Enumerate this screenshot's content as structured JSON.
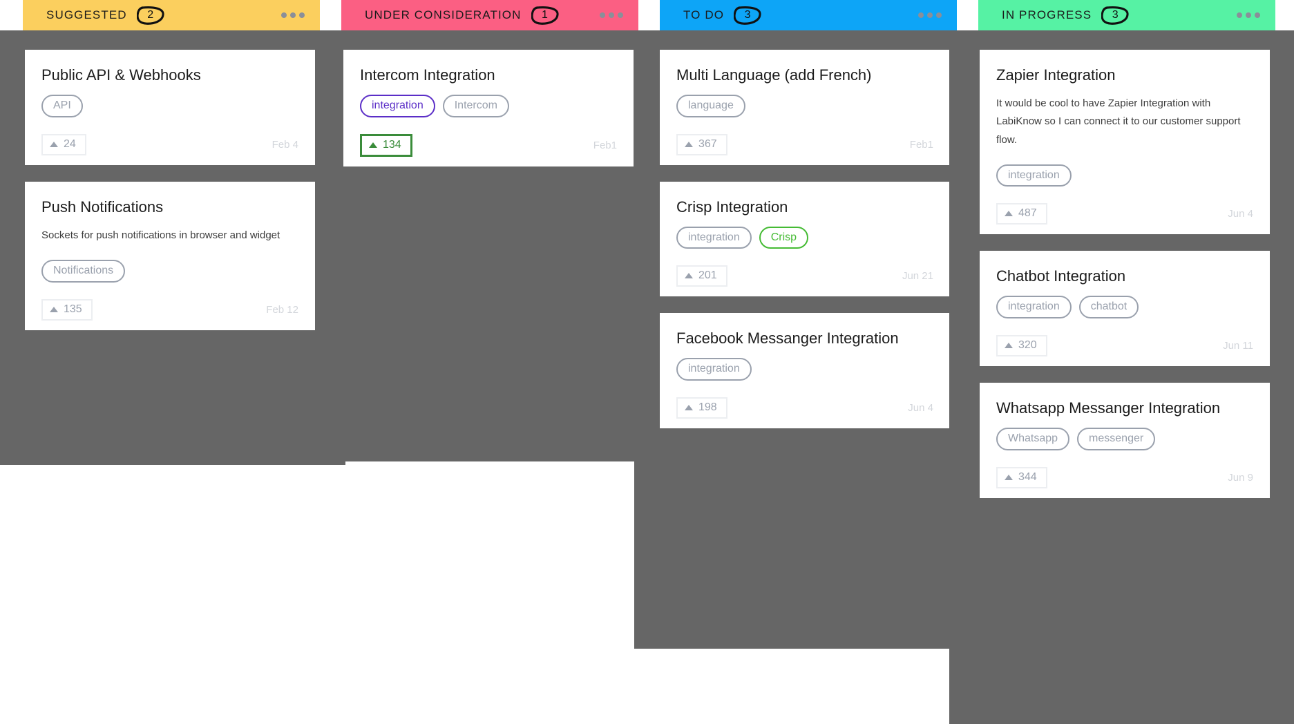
{
  "columns": [
    {
      "id": "suggested",
      "title": "SUGGESTED",
      "count": "2",
      "color": "#fbcf5e",
      "menu_icon": "ellipsis-icon",
      "cards": [
        {
          "title": "Public API & Webhooks",
          "desc": "",
          "tags": [
            {
              "label": "API",
              "state": "default"
            }
          ],
          "votes": "24",
          "voted": false,
          "date": "Feb 4"
        },
        {
          "title": "Push Notifications",
          "desc": "Sockets for push notifications in browser and widget",
          "tags": [
            {
              "label": "Notifications",
              "state": "default"
            }
          ],
          "votes": "135",
          "voted": false,
          "date": "Feb 12"
        }
      ]
    },
    {
      "id": "under-consideration",
      "title": "UNDER CONSIDERATION",
      "count": "1",
      "color": "#fb5f83",
      "menu_icon": "ellipsis-icon",
      "cards": [
        {
          "title": "Intercom Integration",
          "desc": "",
          "tags": [
            {
              "label": "integration",
              "state": "purple"
            },
            {
              "label": "Intercom",
              "state": "default"
            }
          ],
          "votes": "134",
          "voted": true,
          "date": "Feb1"
        }
      ]
    },
    {
      "id": "to-do",
      "title": "TO DO",
      "count": "3",
      "color": "#0da5f7",
      "menu_icon": "ellipsis-icon",
      "cards": [
        {
          "title": "Multi Language (add French)",
          "desc": "",
          "tags": [
            {
              "label": "language",
              "state": "default"
            }
          ],
          "votes": "367",
          "voted": false,
          "date": "Feb1"
        },
        {
          "title": "Crisp Integration",
          "desc": "",
          "tags": [
            {
              "label": "integration",
              "state": "default"
            },
            {
              "label": "Crisp",
              "state": "green"
            }
          ],
          "votes": "201",
          "voted": false,
          "date": "Jun 21"
        },
        {
          "title": "Facebook Messanger Integration",
          "desc": "",
          "tags": [
            {
              "label": "integration",
              "state": "default"
            }
          ],
          "votes": "198",
          "voted": false,
          "date": "Jun 4"
        }
      ]
    },
    {
      "id": "in-progress",
      "title": "IN PROGRESS",
      "count": "3",
      "color": "#56f2a4",
      "menu_icon": "ellipsis-icon",
      "cards": [
        {
          "title": "Zapier Integration",
          "desc": "It would be cool to have Zapier Integration with LabiKnow so I can connect it to our customer support flow.",
          "tags": [
            {
              "label": "integration",
              "state": "default"
            }
          ],
          "votes": "487",
          "voted": false,
          "date": "Jun 4"
        },
        {
          "title": "Chatbot Integration",
          "desc": "",
          "tags": [
            {
              "label": "integration",
              "state": "default"
            },
            {
              "label": "chatbot",
              "state": "default"
            }
          ],
          "votes": "320",
          "voted": false,
          "date": "Jun 11"
        },
        {
          "title": "Whatsapp Messanger Integration",
          "desc": "",
          "tags": [
            {
              "label": "Whatsapp",
              "state": "default"
            },
            {
              "label": "messenger",
              "state": "default"
            }
          ],
          "votes": "344",
          "voted": false,
          "date": "Jun 9"
        }
      ]
    }
  ]
}
